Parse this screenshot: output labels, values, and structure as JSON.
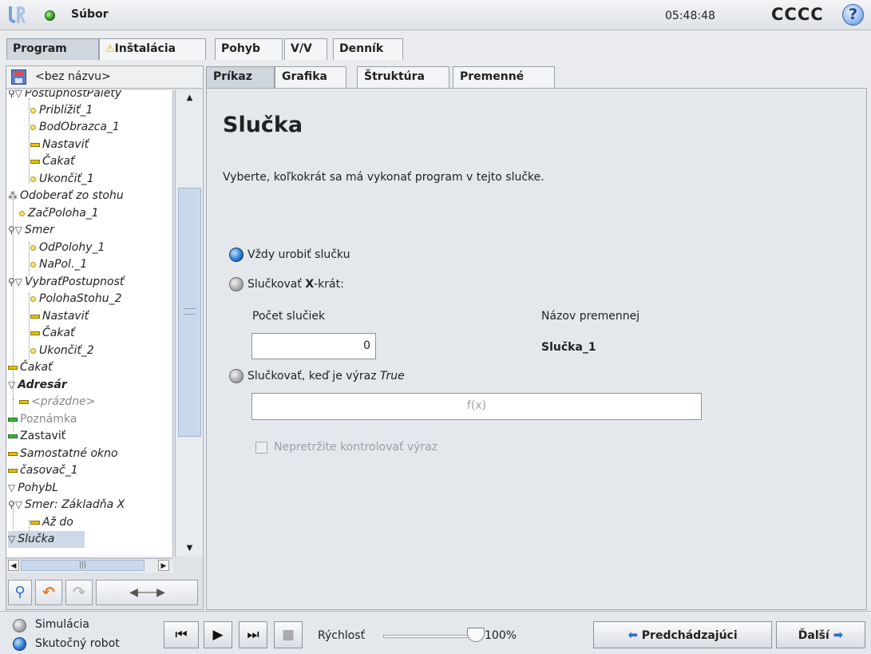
{
  "titlebar": {
    "file_menu": "Súbor",
    "clock": "05:48:48",
    "robot_name": "CCCC",
    "help": "?"
  },
  "main_tabs": [
    {
      "label": "Program"
    },
    {
      "label": "Inštalácia"
    },
    {
      "label": "Pohyb"
    },
    {
      "label": "V/V"
    },
    {
      "label": "Denník"
    }
  ],
  "program": {
    "name": "<bez názvu>"
  },
  "tree": {
    "items": [
      {
        "label": "PostupnosťPalety"
      },
      {
        "label": "Priblížiť_1"
      },
      {
        "label": "BodObrazca_1"
      },
      {
        "label": "Nastaviť"
      },
      {
        "label": "Čakať"
      },
      {
        "label": "Ukončiť_1"
      },
      {
        "label": "Odoberať zo stohu"
      },
      {
        "label": "ZačPoloha_1"
      },
      {
        "label": "Smer"
      },
      {
        "label": "OdPolohy_1"
      },
      {
        "label": "NaPol._1"
      },
      {
        "label": "VybraťPostupnosť"
      },
      {
        "label": "PolohaStohu_2"
      },
      {
        "label": "Nastaviť"
      },
      {
        "label": "Čakať"
      },
      {
        "label": "Ukončiť_2"
      },
      {
        "label": "Čakať"
      },
      {
        "label": "Adresár"
      },
      {
        "label": "<prázdne>"
      },
      {
        "label": "Poznámka"
      },
      {
        "label": "Zastaviť"
      },
      {
        "label": "Samostatné okno"
      },
      {
        "label": "časovač_1"
      },
      {
        "label": "PohybL"
      },
      {
        "label": "Smer: Základňa X"
      },
      {
        "label": "Až do"
      },
      {
        "label": "Slučka"
      }
    ]
  },
  "sub_tabs": [
    {
      "label": "Príkaz"
    },
    {
      "label": "Grafika"
    },
    {
      "label": "Štruktúra"
    },
    {
      "label": "Premenné"
    }
  ],
  "content": {
    "heading": "Slučka",
    "description": "Vyberte, koľkokrát sa má vykonať program v tejto slučke.",
    "option_always": "Vždy urobiť slučku",
    "option_x_prefix": "Slučkovať ",
    "option_x_bold": "X",
    "option_x_suffix": "-krát:",
    "count_label": "Počet slučiek",
    "count_value": "0",
    "var_name_label": "Názov premennej",
    "var_name_value": "Slučka_1",
    "option_expr_prefix": "Slučkovať, keď je výraz ",
    "option_expr_italic": "True",
    "expr_placeholder": "f(x)",
    "continuous_check_label": "Nepretržite kontrolovať výraz"
  },
  "footer": {
    "mode_simulation": "Simulácia",
    "mode_real": "Skutočný robot",
    "speed_label": "Rýchlosť",
    "speed_value": "100%",
    "speed_fraction": 1.0,
    "prev_label": "Predchádzajúci",
    "next_label": "Ďalší"
  }
}
